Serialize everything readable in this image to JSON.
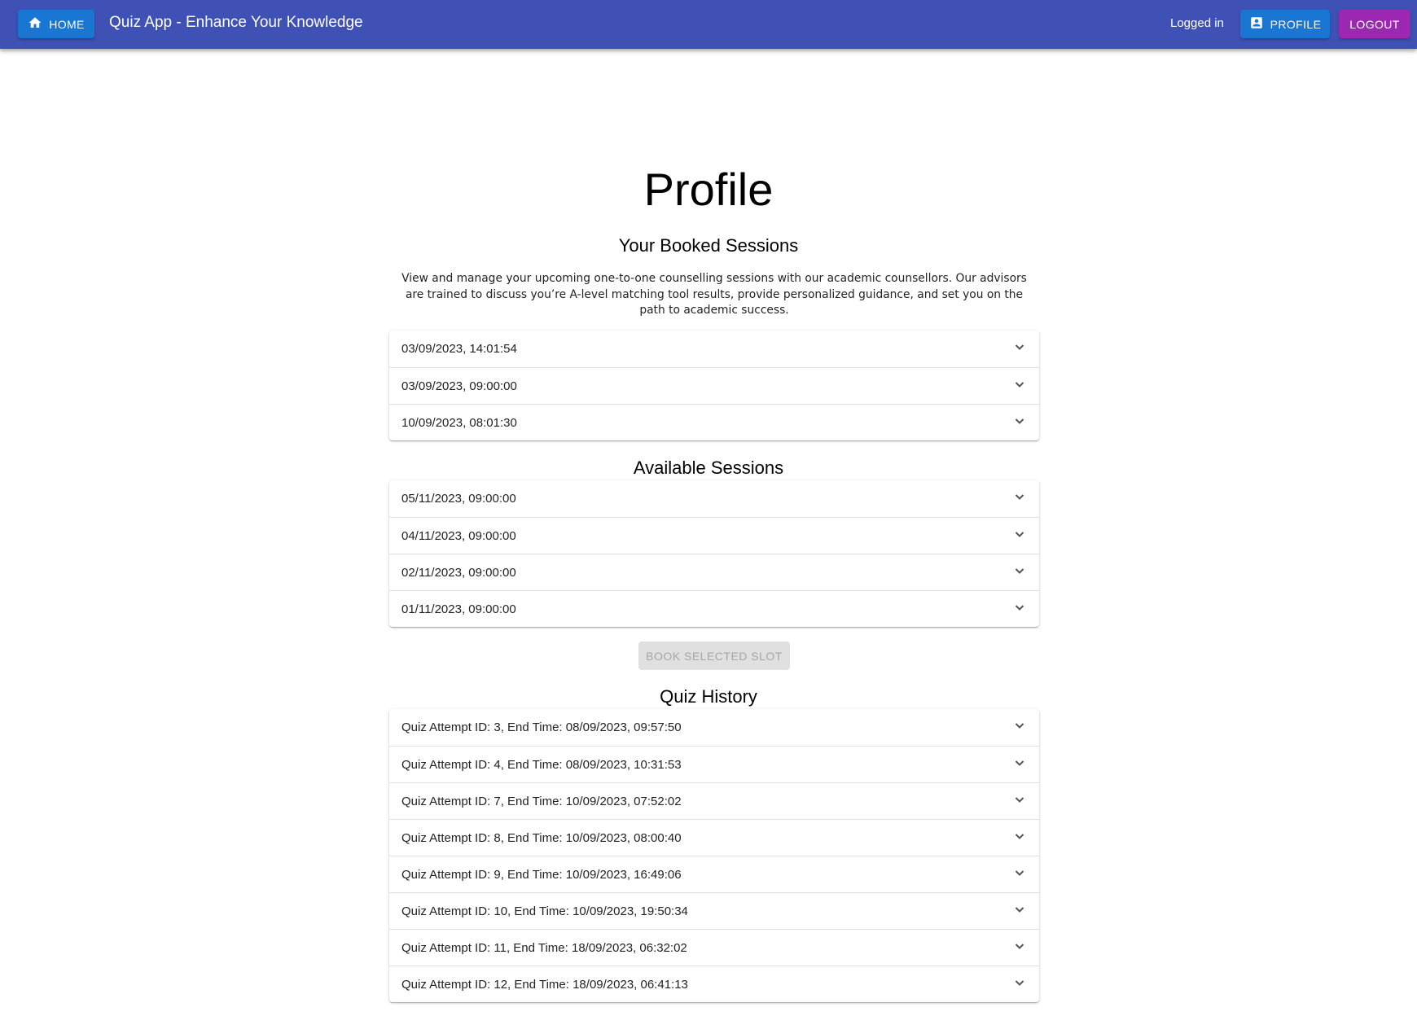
{
  "appbar": {
    "home_label": "HOME",
    "title": "Quiz App - Enhance Your Knowledge",
    "status": "Logged in",
    "profile_label": "PROFILE",
    "logout_label": "LOGOUT",
    "colors": {
      "bar": "#3f51b5",
      "primary": "#1976d2",
      "secondary": "#9c27b0"
    }
  },
  "page": {
    "title": "Profile"
  },
  "booked": {
    "heading": "Your Booked Sessions",
    "description": "View and manage your upcoming one-to-one counselling sessions with our academic counsellors. Our advisors are trained to discuss you’re A-level matching tool results, provide personalized guidance, and set you on the path to academic success.",
    "items": [
      "03/09/2023, 14:01:54",
      "03/09/2023, 09:00:00",
      "10/09/2023, 08:01:30"
    ]
  },
  "available": {
    "heading": "Available Sessions",
    "items": [
      "05/11/2023, 09:00:00",
      "04/11/2023, 09:00:00",
      "02/11/2023, 09:00:00",
      "01/11/2023, 09:00:00"
    ],
    "book_label": "BOOK SELECTED SLOT"
  },
  "history": {
    "heading": "Quiz History",
    "items": [
      "Quiz Attempt ID: 3, End Time: 08/09/2023, 09:57:50",
      "Quiz Attempt ID: 4, End Time: 08/09/2023, 10:31:53",
      "Quiz Attempt ID: 7, End Time: 10/09/2023, 07:52:02",
      "Quiz Attempt ID: 8, End Time: 10/09/2023, 08:00:40",
      "Quiz Attempt ID: 9, End Time: 10/09/2023, 16:49:06",
      "Quiz Attempt ID: 10, End Time: 10/09/2023, 19:50:34",
      "Quiz Attempt ID: 11, End Time: 18/09/2023, 06:32:02",
      "Quiz Attempt ID: 12, End Time: 18/09/2023, 06:41:13"
    ]
  },
  "icons": {
    "home": "home-icon",
    "profile": "account-box-icon",
    "expand": "chevron-down-icon"
  }
}
